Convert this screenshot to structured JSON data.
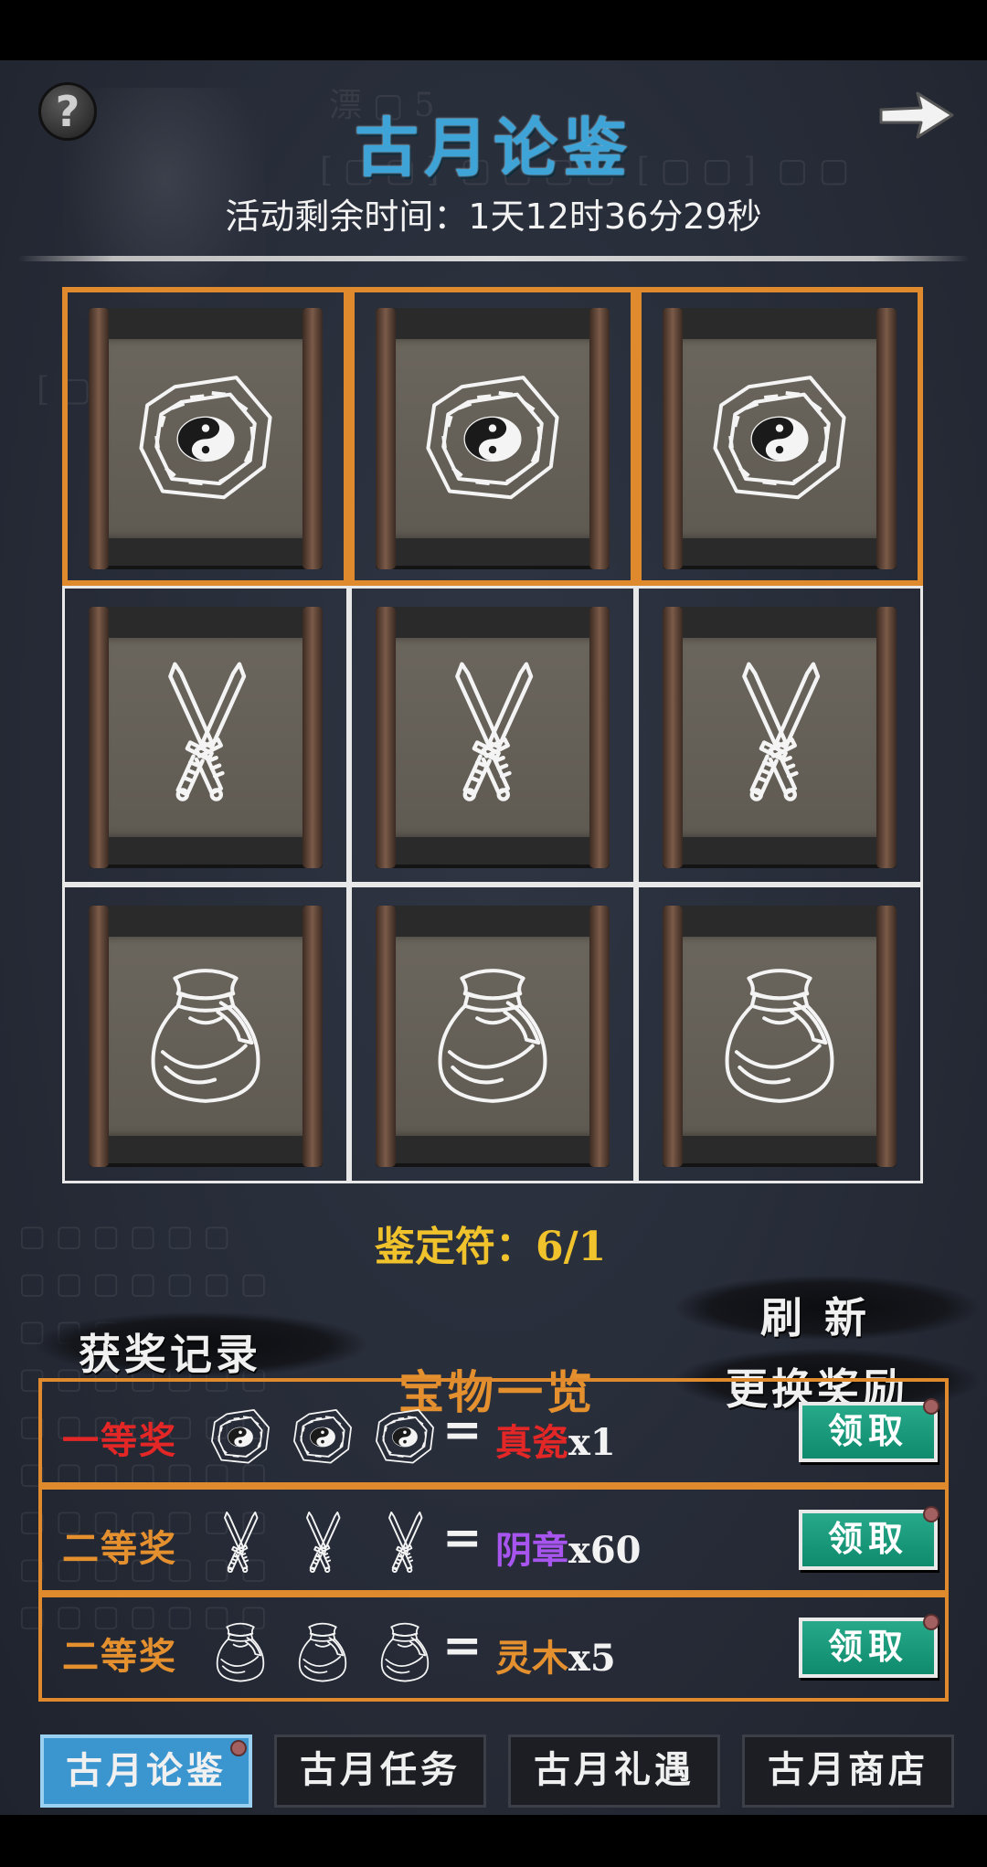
{
  "header": {
    "title": "古月论鉴",
    "timer_label": "活动剩余时间：",
    "timer_value": "1天12时36分29秒",
    "help_label": "?"
  },
  "grid": {
    "rows": [
      {
        "item": "bagua-icon",
        "highlighted": true
      },
      {
        "item": "crossed-swords-icon",
        "highlighted": false
      },
      {
        "item": "pouch-icon",
        "highlighted": false
      }
    ]
  },
  "controls": {
    "counter_label": "鉴定符：",
    "counter_value": "6/1",
    "records_label": "获奖记录",
    "refresh_label": "刷 新",
    "treasure_label": "宝物一览",
    "change_reward_label": "更换奖励"
  },
  "prizes": [
    {
      "rank": "一等奖",
      "rank_color": "#e32626",
      "icon": "bagua-icon",
      "equals": "=",
      "reward": "真瓷",
      "reward_color": "#e32626",
      "qty": "x1",
      "claim": "领取"
    },
    {
      "rank": "二等奖",
      "rank_color": "#e5902f",
      "icon": "crossed-swords-icon",
      "equals": "=",
      "reward": "阴章",
      "reward_color": "#a855f0",
      "qty": "x60",
      "claim": "领取"
    },
    {
      "rank": "二等奖",
      "rank_color": "#e5902f",
      "icon": "pouch-icon",
      "equals": "=",
      "reward": "灵木",
      "reward_color": "#e5902f",
      "qty": "x5",
      "claim": "领取"
    }
  ],
  "tabs": [
    {
      "label": "古月论鉴",
      "active": true
    },
    {
      "label": "古月任务",
      "active": false
    },
    {
      "label": "古月礼遇",
      "active": false
    },
    {
      "label": "古月商店",
      "active": false
    }
  ],
  "colors": {
    "accent_orange": "#e08a2e",
    "title_blue": "#3ea4d8",
    "counter_gold": "#f0c22c",
    "claim_green": "#14977a"
  }
}
